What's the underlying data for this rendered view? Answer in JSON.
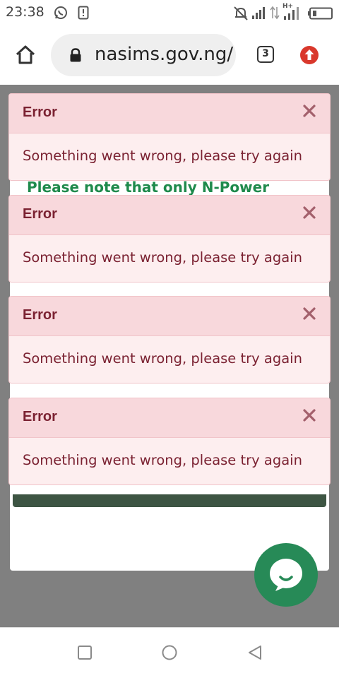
{
  "status_bar": {
    "time": "23:38",
    "network_label": "H+"
  },
  "browser": {
    "url": "nasims.gov.ng/",
    "tab_count": "3"
  },
  "page": {
    "notice_text": "Please note that only N-Power"
  },
  "toasts": [
    {
      "title": "Error",
      "message": "Something went wrong, please try again"
    },
    {
      "title": "Error",
      "message": "Something went wrong, please try again"
    },
    {
      "title": "Error",
      "message": "Something went wrong, please try again"
    },
    {
      "title": "Error",
      "message": "Something went wrong, please try again"
    }
  ],
  "icons": {
    "status_left": [
      "whatsapp-icon",
      "alert-icon"
    ],
    "status_right": [
      "muted-bell-icon",
      "signal-icon",
      "data-transfer-icon",
      "signal-icon-2",
      "battery-icon"
    ],
    "browser": [
      "home-icon",
      "lock-icon",
      "tabs-icon",
      "update-icon"
    ],
    "page": [
      "close-icon",
      "chat-icon"
    ],
    "nav": [
      "recents-icon",
      "home-nav-icon",
      "back-icon"
    ]
  },
  "colors": {
    "toast_header_bg": "#f8d8dc",
    "toast_body_bg": "#fdeeef",
    "toast_text": "#7b2232",
    "notice_green": "#1f8a4c",
    "chat_fab_green": "#278a57",
    "overlay_gray": "#808080"
  }
}
